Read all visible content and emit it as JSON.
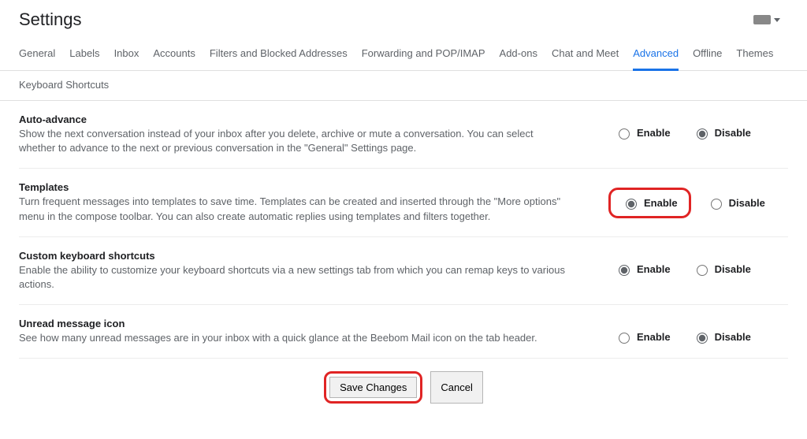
{
  "page_title": "Settings",
  "tabs": {
    "general": "General",
    "labels": "Labels",
    "inbox": "Inbox",
    "accounts": "Accounts",
    "filters": "Filters and Blocked Addresses",
    "forwarding": "Forwarding and POP/IMAP",
    "addons": "Add-ons",
    "chat": "Chat and Meet",
    "advanced": "Advanced",
    "offline": "Offline",
    "themes": "Themes",
    "keyboard": "Keyboard Shortcuts"
  },
  "option_labels": {
    "enable": "Enable",
    "disable": "Disable"
  },
  "settings": {
    "auto_advance": {
      "title": "Auto-advance",
      "desc": "Show the next conversation instead of your inbox after you delete, archive or mute a conversation. You can select whether to advance to the next or previous conversation in the \"General\" Settings page.",
      "value": "disable"
    },
    "templates": {
      "title": "Templates",
      "desc": "Turn frequent messages into templates to save time. Templates can be created and inserted through the \"More options\" menu in the compose toolbar. You can also create automatic replies using templates and filters together.",
      "value": "enable",
      "highlighted": true
    },
    "custom_shortcuts": {
      "title": "Custom keyboard shortcuts",
      "desc": "Enable the ability to customize your keyboard shortcuts via a new settings tab from which you can remap keys to various actions.",
      "value": "enable"
    },
    "unread_icon": {
      "title": "Unread message icon",
      "desc": "See how many unread messages are in your inbox with a quick glance at the Beebom Mail icon on the tab header.",
      "value": "disable"
    }
  },
  "buttons": {
    "save": "Save Changes",
    "cancel": "Cancel"
  }
}
